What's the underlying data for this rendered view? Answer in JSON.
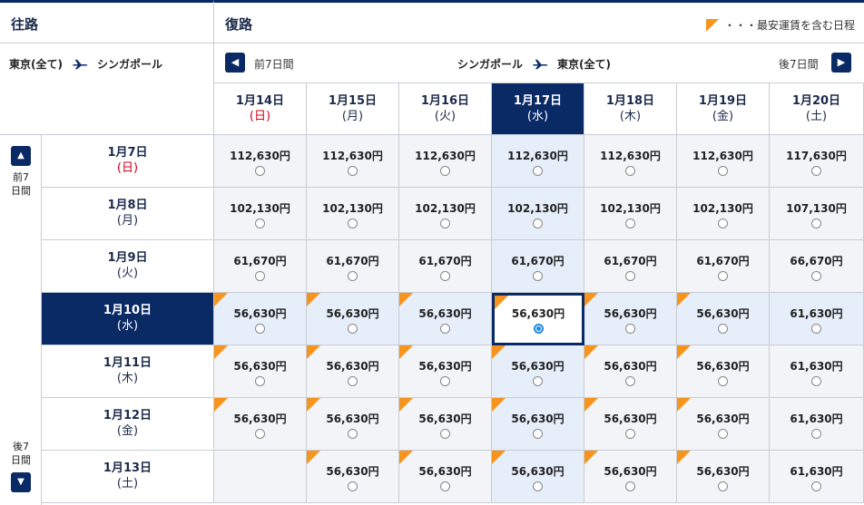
{
  "header": {
    "outbound_title": "往路",
    "return_title": "復路",
    "legend_text": "・・・最安運賃を含む日程"
  },
  "outbound_route": {
    "from": "東京(全て)",
    "to": "シンガポール"
  },
  "return_route": {
    "from": "シンガポール",
    "to": "東京(全て)"
  },
  "nav": {
    "prev7": "前7日間",
    "next7": "後7日間",
    "prev_arrow": "◀",
    "next_arrow": "▶",
    "up_arrow": "▲",
    "down_arrow": "▼",
    "prev7_vertical": "前7日間",
    "next7_vertical": "後7日間"
  },
  "columns": [
    {
      "date": "1月14日",
      "weekday": "(日)",
      "sunday": true
    },
    {
      "date": "1月15日",
      "weekday": "(月)"
    },
    {
      "date": "1月16日",
      "weekday": "(火)"
    },
    {
      "date": "1月17日",
      "weekday": "(水)",
      "selected": true
    },
    {
      "date": "1月18日",
      "weekday": "(木)"
    },
    {
      "date": "1月19日",
      "weekday": "(金)"
    },
    {
      "date": "1月20日",
      "weekday": "(土)"
    }
  ],
  "rows": [
    {
      "date": "1月7日",
      "weekday": "(日)",
      "sunday": true,
      "prices": [
        "112,630円",
        "112,630円",
        "112,630円",
        "112,630円",
        "112,630円",
        "112,630円",
        "117,630円"
      ],
      "cheapest": [
        false,
        false,
        false,
        false,
        false,
        false,
        false
      ]
    },
    {
      "date": "1月8日",
      "weekday": "(月)",
      "prices": [
        "102,130円",
        "102,130円",
        "102,130円",
        "102,130円",
        "102,130円",
        "102,130円",
        "107,130円"
      ],
      "cheapest": [
        false,
        false,
        false,
        false,
        false,
        false,
        false
      ]
    },
    {
      "date": "1月9日",
      "weekday": "(火)",
      "prices": [
        "61,670円",
        "61,670円",
        "61,670円",
        "61,670円",
        "61,670円",
        "61,670円",
        "66,670円"
      ],
      "cheapest": [
        false,
        false,
        false,
        false,
        false,
        false,
        false
      ]
    },
    {
      "date": "1月10日",
      "weekday": "(水)",
      "selected": true,
      "prices": [
        "56,630円",
        "56,630円",
        "56,630円",
        "56,630円",
        "56,630円",
        "56,630円",
        "61,630円"
      ],
      "cheapest": [
        true,
        true,
        true,
        true,
        true,
        true,
        false
      ]
    },
    {
      "date": "1月11日",
      "weekday": "(木)",
      "prices": [
        "56,630円",
        "56,630円",
        "56,630円",
        "56,630円",
        "56,630円",
        "56,630円",
        "61,630円"
      ],
      "cheapest": [
        true,
        true,
        true,
        true,
        true,
        true,
        false
      ]
    },
    {
      "date": "1月12日",
      "weekday": "(金)",
      "prices": [
        "56,630円",
        "56,630円",
        "56,630円",
        "56,630円",
        "56,630円",
        "56,630円",
        "61,630円"
      ],
      "cheapest": [
        true,
        true,
        true,
        true,
        true,
        true,
        false
      ]
    },
    {
      "date": "1月13日",
      "weekday": "(土)",
      "prices": [
        "",
        "56,630円",
        "56,630円",
        "56,630円",
        "56,630円",
        "56,630円",
        "61,630円"
      ],
      "cheapest": [
        false,
        true,
        true,
        true,
        true,
        true,
        false
      ]
    }
  ],
  "selected_cell": {
    "row": 3,
    "col": 3
  },
  "colors": {
    "navy": "#0a2a66",
    "orange": "#f7941d",
    "sunday_red": "#d0021b",
    "radio_blue": "#1e88e5"
  },
  "icons": {
    "plane": "airplane-icon",
    "triangle": "cheapest-flag-icon"
  }
}
